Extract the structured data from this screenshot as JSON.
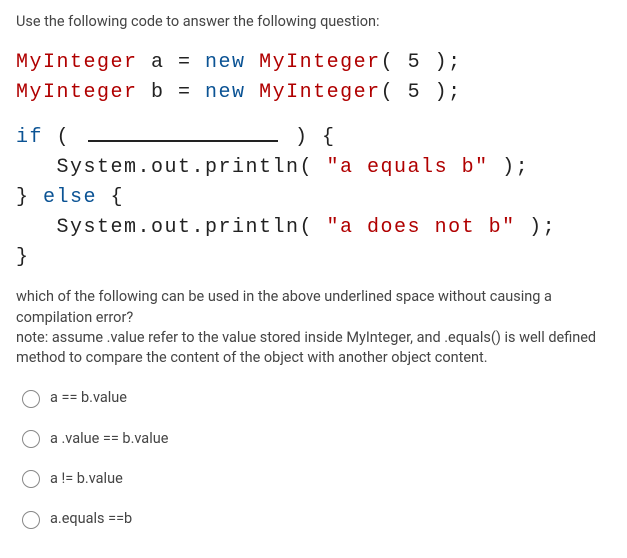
{
  "intro": "Use the following code to answer the following question:",
  "code": {
    "line1_a": "MyInteger",
    "line1_b": " a = ",
    "line1_c": "new ",
    "line1_d": "MyInteger",
    "line1_e": "( 5 );",
    "line2_a": "MyInteger",
    "line2_b": " b = ",
    "line2_c": "new ",
    "line2_d": "MyInteger",
    "line2_e": "( 5 );",
    "line3_a": "if",
    "line3_b": " ( ",
    "line3_c": " ) {",
    "line4_a": "   System.out.println( ",
    "line4_b": "\"a equals b\"",
    "line4_c": " );",
    "line5_a": "} ",
    "line5_b": "else",
    "line5_c": " {",
    "line6_a": "   System.out.println( ",
    "line6_b": "\"a does not b\"",
    "line6_c": " );",
    "line7": "}"
  },
  "followup": "which of the following can be used in the above underlined space without causing a compilation error?\nnote: assume .value refer to the value stored inside MyInteger, and .equals() is well defined method to compare the content of the object with another object content.",
  "options": [
    "a == b.value",
    "a .value == b.value",
    "a != b.value",
    "a.equals ==b"
  ]
}
